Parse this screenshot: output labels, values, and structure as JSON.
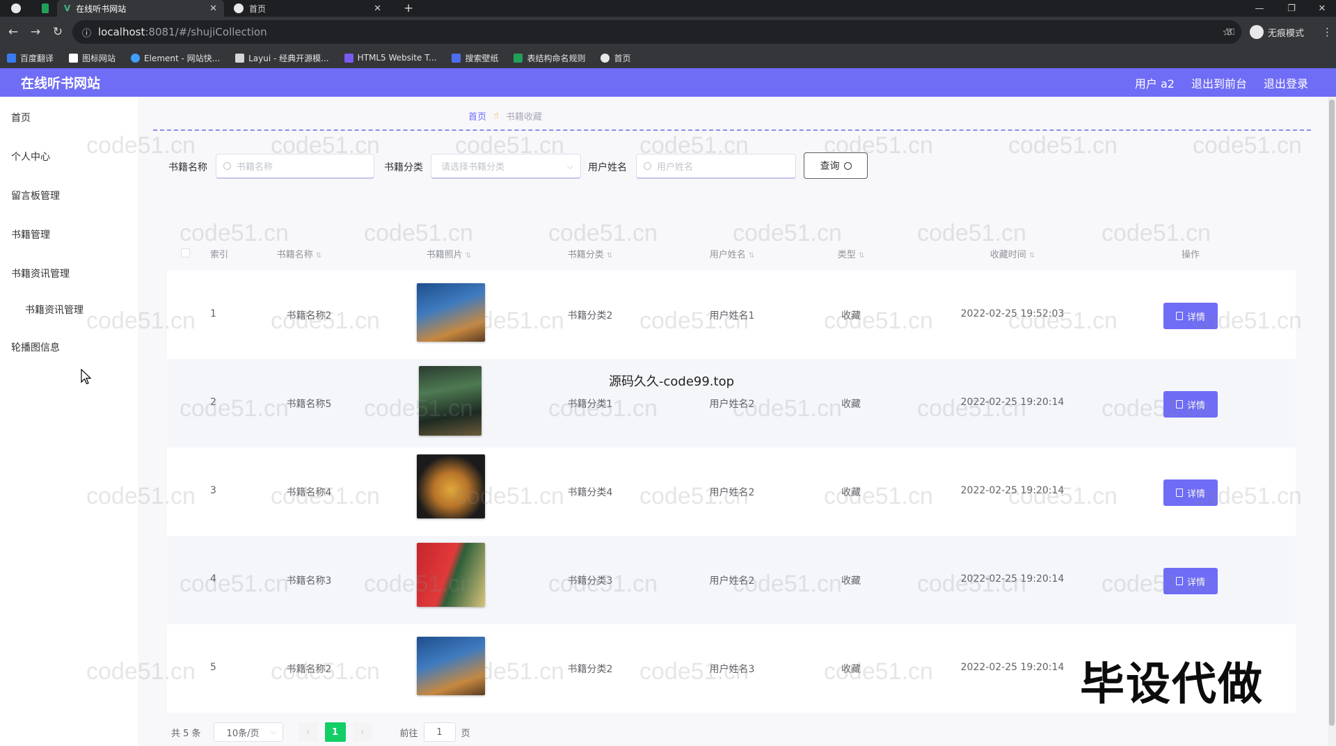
{
  "browser": {
    "tabs": [
      {
        "title": "在线听书网站",
        "active": true
      },
      {
        "title": "首页",
        "active": false
      }
    ],
    "new_tab": "+",
    "url_host": "localhost",
    "url_rest": ":8081/#/shujiCollection",
    "profile_label": "无痕模式",
    "bookmarks": [
      "百度翻译",
      "图标网站",
      "Element - 网站快...",
      "Layui - 经典开源模...",
      "HTML5 Website T...",
      "搜索壁纸",
      "表结构命名规则",
      "首页"
    ]
  },
  "header": {
    "title": "在线听书网站",
    "user": "用户 a2",
    "to_front": "退出到前台",
    "logout": "退出登录"
  },
  "sidebar": {
    "items": [
      "首页",
      "个人中心",
      "留言板管理",
      "书籍管理",
      "书籍资讯管理",
      "书籍资讯管理",
      "轮播图信息"
    ]
  },
  "breadcrumb": {
    "home": "首页",
    "current": "书籍收藏"
  },
  "search": {
    "name_label": "书籍名称",
    "name_placeholder": "书籍名称",
    "category_label": "书籍分类",
    "category_placeholder": "请选择书籍分类",
    "user_label": "用户姓名",
    "user_placeholder": "用户姓名",
    "query_button": "查询"
  },
  "table": {
    "headers": [
      "索引",
      "书籍名称",
      "书籍照片",
      "书籍分类",
      "用户姓名",
      "类型",
      "收藏时间",
      "操作"
    ],
    "rows": [
      {
        "index": "1",
        "name": "书籍名称2",
        "category": "书籍分类2",
        "user": "用户姓名1",
        "type": "收藏",
        "time": "2022-02-25 19:52:03",
        "action": "详情"
      },
      {
        "index": "2",
        "name": "书籍名称5",
        "category": "书籍分类1",
        "user": "用户姓名2",
        "type": "收藏",
        "time": "2022-02-25 19:20:14",
        "action": "详情"
      },
      {
        "index": "3",
        "name": "书籍名称4",
        "category": "书籍分类4",
        "user": "用户姓名2",
        "type": "收藏",
        "time": "2022-02-25 19:20:14",
        "action": "详情"
      },
      {
        "index": "4",
        "name": "书籍名称3",
        "category": "书籍分类3",
        "user": "用户姓名2",
        "type": "收藏",
        "time": "2022-02-25 19:20:14",
        "action": "详情"
      },
      {
        "index": "5",
        "name": "书籍名称2",
        "category": "书籍分类2",
        "user": "用户姓名3",
        "type": "收藏",
        "time": "2022-02-25 19:20:14",
        "action": "详情"
      }
    ]
  },
  "pagination": {
    "total": "共 5 条",
    "page_size": "10条/页",
    "current_page": "1",
    "goto_label": "前往",
    "goto_value": "1",
    "page_unit": "页"
  },
  "overlays": {
    "watermark": "code51.cn",
    "center_text": "源码久久-code99.top",
    "corner_text": "毕设代做"
  },
  "colors": {
    "accent": "#6f6cf5",
    "active_page": "#13ce66"
  }
}
